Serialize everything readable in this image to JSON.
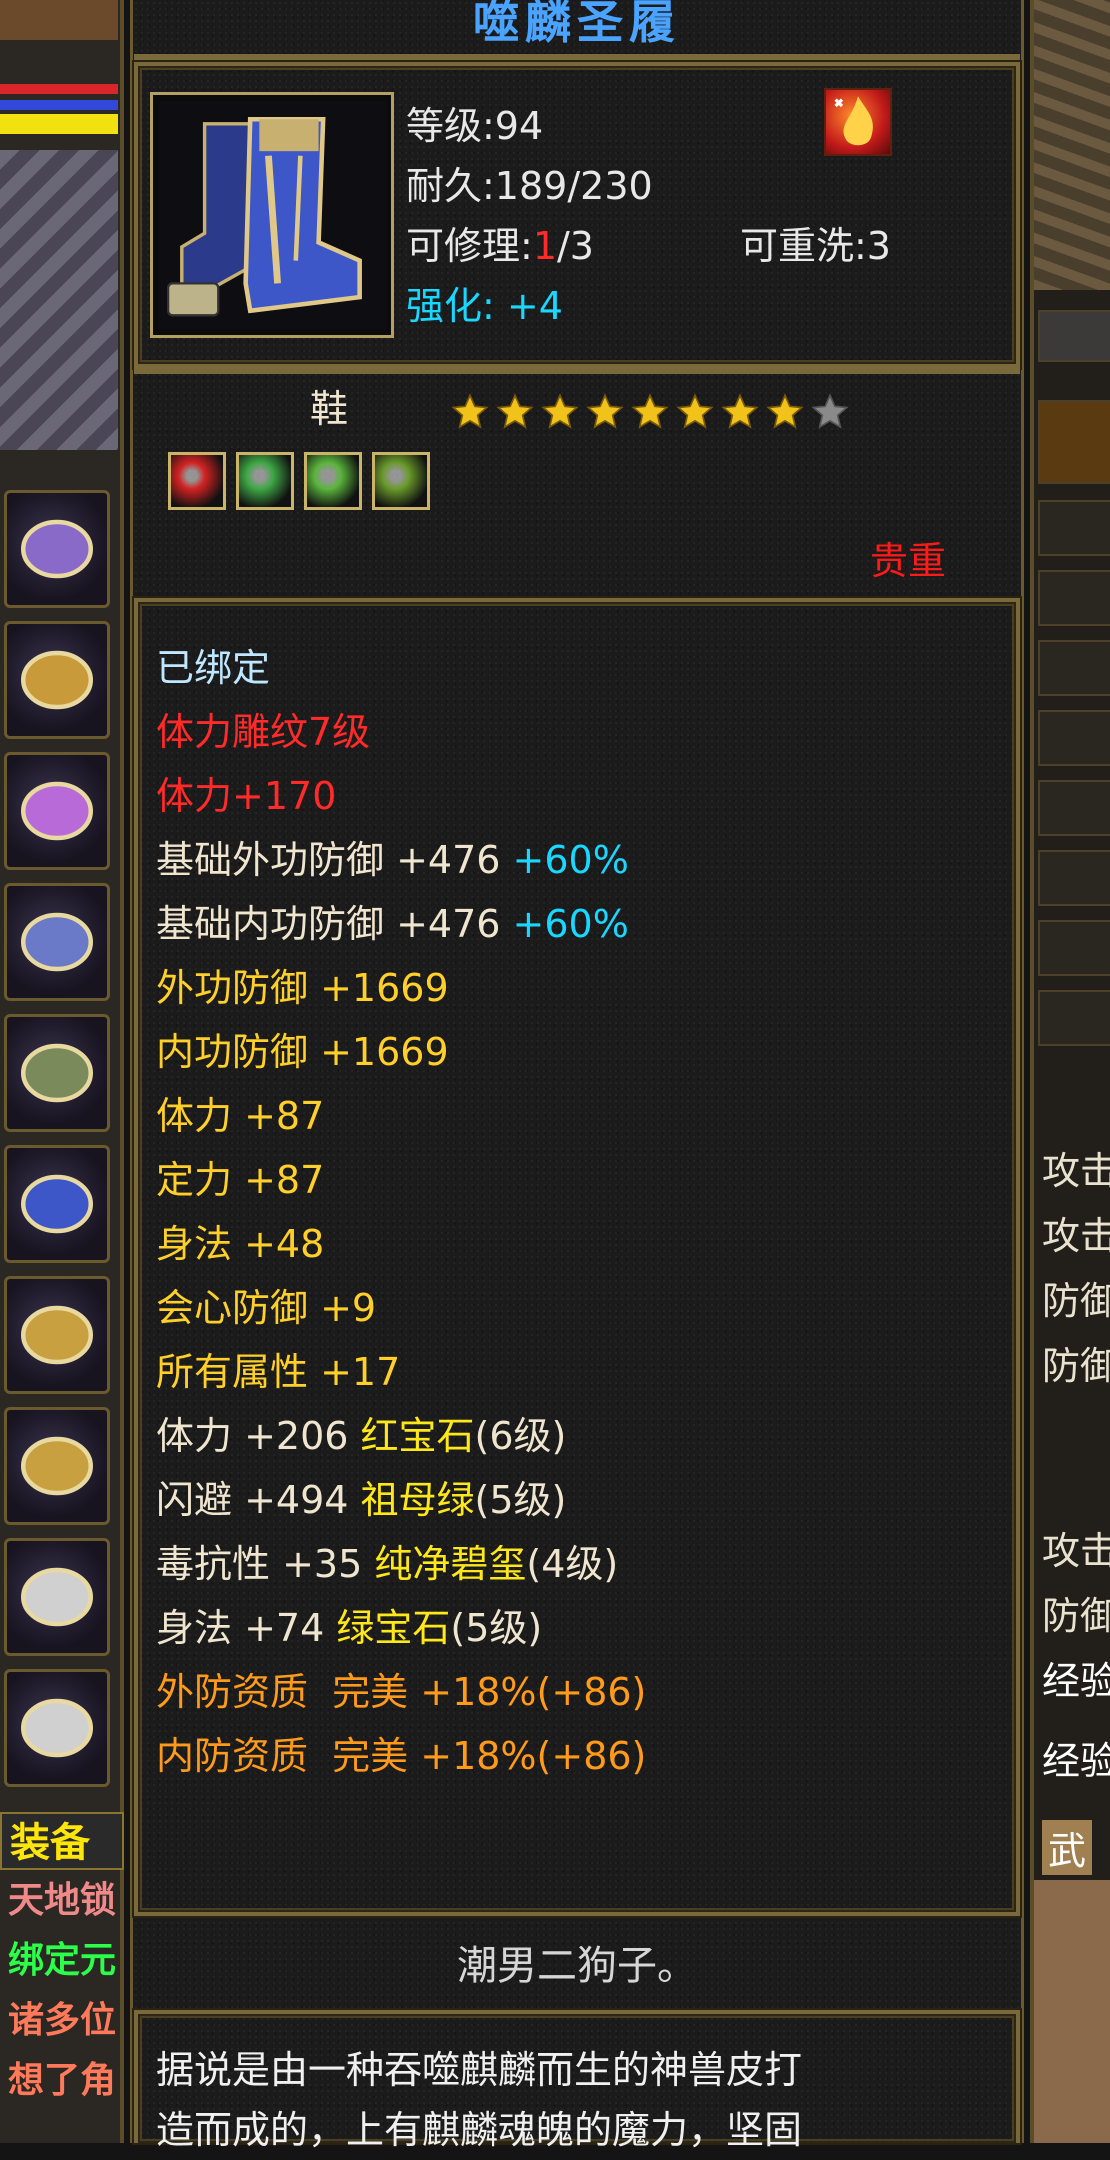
{
  "item": {
    "name": "噬麟圣履",
    "level": "等级:94",
    "durability": "耐久:189/230",
    "repair_prefix": "可修理:",
    "repair_used": "1",
    "repair_suffix": "/3",
    "rewash": "可重洗:3",
    "enhance_label": "强化:",
    "enhance_value": "+4",
    "type": "鞋",
    "stars_filled": 8,
    "stars_total": 9,
    "gem_sockets": [
      {
        "color": "#d22222",
        "name": "red-gem-icon"
      },
      {
        "color": "#3ea845",
        "name": "green-gem-icon"
      },
      {
        "color": "#5ab53c",
        "name": "green-gem-icon"
      },
      {
        "color": "#6a9a2a",
        "name": "jade-gem-icon"
      }
    ],
    "rarity": "贵重"
  },
  "attributes": [
    {
      "segments": [
        {
          "t": "已绑定",
          "c": "#bfe7ff"
        }
      ]
    },
    {
      "segments": [
        {
          "t": "体力雕纹7级",
          "c": "#ff2a2a"
        }
      ]
    },
    {
      "segments": [
        {
          "t": "体力+170",
          "c": "#ff2a2a"
        }
      ]
    },
    {
      "segments": [
        {
          "t": "基础外功防御 +476 ",
          "c": "#f0e6cf"
        },
        {
          "t": "+60%",
          "c": "#19d7ff"
        }
      ]
    },
    {
      "segments": [
        {
          "t": "基础内功防御 +476 ",
          "c": "#f0e6cf"
        },
        {
          "t": "+60%",
          "c": "#19d7ff"
        }
      ]
    },
    {
      "segments": [
        {
          "t": "外功防御 +1669",
          "c": "#ffcf2a"
        }
      ]
    },
    {
      "segments": [
        {
          "t": "内功防御 +1669",
          "c": "#ffcf2a"
        }
      ]
    },
    {
      "segments": [
        {
          "t": "体力 +87",
          "c": "#ffcf2a"
        }
      ]
    },
    {
      "segments": [
        {
          "t": "定力 +87",
          "c": "#ffcf2a"
        }
      ]
    },
    {
      "segments": [
        {
          "t": "身法 +48",
          "c": "#ffcf2a"
        }
      ]
    },
    {
      "segments": [
        {
          "t": "会心防御 +9",
          "c": "#ffcf2a"
        }
      ]
    },
    {
      "segments": [
        {
          "t": "所有属性 +17",
          "c": "#ffcf2a"
        }
      ]
    },
    {
      "segments": [
        {
          "t": "体力 +206 ",
          "c": "#f0e6cf"
        },
        {
          "t": "红宝石",
          "c": "#ffe81a"
        },
        {
          "t": "(6级)",
          "c": "#f0e6cf"
        }
      ]
    },
    {
      "segments": [
        {
          "t": "闪避 +494 ",
          "c": "#f0e6cf"
        },
        {
          "t": "祖母绿",
          "c": "#ffe81a"
        },
        {
          "t": "(5级)",
          "c": "#f0e6cf"
        }
      ]
    },
    {
      "segments": [
        {
          "t": "毒抗性 +35 ",
          "c": "#f0e6cf"
        },
        {
          "t": "纯净碧玺",
          "c": "#ffe81a"
        },
        {
          "t": "(4级)",
          "c": "#f0e6cf"
        }
      ]
    },
    {
      "segments": [
        {
          "t": "身法 +74 ",
          "c": "#f0e6cf"
        },
        {
          "t": "绿宝石",
          "c": "#ffe81a"
        },
        {
          "t": "(5级)",
          "c": "#f0e6cf"
        }
      ]
    },
    {
      "segments": [
        {
          "t": "外防资质  完美 +18%(+86)",
          "c": "#ff9a1a"
        }
      ]
    },
    {
      "segments": [
        {
          "t": "内防资质  完美 +18%(+86)",
          "c": "#ff9a1a"
        }
      ]
    }
  ],
  "owner_note": "潮男二狗子。",
  "description": [
    "据说是由一种吞噬麒麟而生的神兽皮打",
    "造而成的，上有麒麟魂魄的魔力，坚固"
  ],
  "left_panel": {
    "equip_tab": "装备",
    "chat_lines": [
      "天地锁",
      "绑定元",
      "诸多位",
      "想了角"
    ],
    "slot_icons": [
      "helmet-icon",
      "shoulder-icon",
      "bracer-icon",
      "glove-icon",
      "belt-icon",
      "boots-icon",
      "ring-icon",
      "ring-icon",
      "amulet-icon",
      "amulet-icon"
    ]
  },
  "right_panel": {
    "labels": [
      "攻击",
      "攻击",
      "防御",
      "防御",
      "攻击",
      "防御",
      "经验",
      "经验",
      "武"
    ]
  }
}
